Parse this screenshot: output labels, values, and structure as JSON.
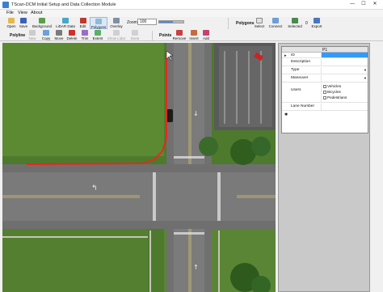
{
  "window": {
    "title": "TScan-DCM Initial Setup and Data Collection Module",
    "min": "—",
    "max": "☐",
    "close": "✕"
  },
  "menu": {
    "file": "File",
    "view": "View",
    "about": "About"
  },
  "toolbar": {
    "open": "Open",
    "save": "Save",
    "background": "Background",
    "lidar_data": "LiDAR Data",
    "edit": "Edit",
    "polygons": "Polygons",
    "overlay": "Overlay",
    "zoom_label": "Zoom",
    "zoom_value": "100",
    "zoom_level_fraction": 0.55,
    "polygons_group": "Polygons",
    "select": "Select",
    "connect": "Connect",
    "selected": "Selected",
    "selected_count": "0",
    "export": "Export"
  },
  "toolbar2": {
    "polyline_group": "Polyline",
    "new": "New",
    "copy": "Copy",
    "move": "Move",
    "delete": "Delete",
    "trim": "Trim",
    "extent": "Extent",
    "show_lidar": "Show Lidar",
    "done": "Done",
    "points_group": "Points",
    "remove": "Remove",
    "insert": "Insert",
    "add": "Add"
  },
  "properties": {
    "header_value": "P1",
    "rows": {
      "id": "ID",
      "description": "Description",
      "type": "Type",
      "maneuver": "Maneuver",
      "users": "Users",
      "lane_number": "Lane Number"
    },
    "users_options": [
      "Vehicles",
      "Bicycles",
      "Pedestrians"
    ],
    "new_row_marker": "✱",
    "current_row_marker": "▸"
  },
  "colors": {
    "polyline": "#e8271f",
    "grass": "#4f7a2f",
    "road": "#6e6e6e",
    "selection": "#3399ff"
  }
}
